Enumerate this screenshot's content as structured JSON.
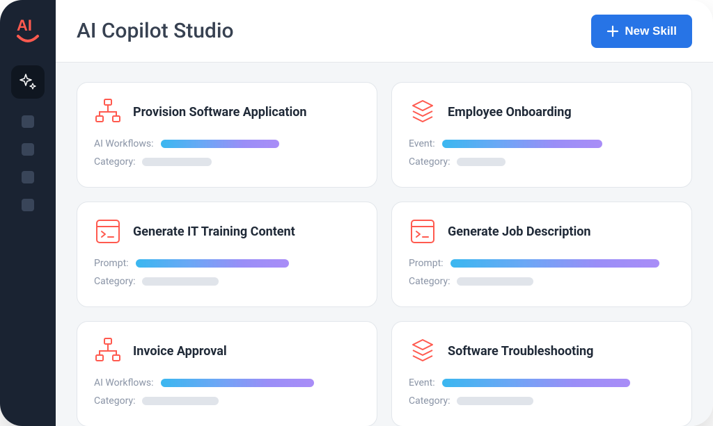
{
  "header": {
    "title": "AI Copilot Studio",
    "new_skill_label": "New Skill"
  },
  "sidebar": {
    "logo": "AI",
    "active_item": "sparkle"
  },
  "cards": [
    {
      "title": "Provision Software Application",
      "icon": "sitemap",
      "row1_label": "AI Workflows:",
      "row1_bar_width": 170,
      "row2_label": "Category:",
      "row2_bar_width": 100
    },
    {
      "title": "Employee Onboarding",
      "icon": "stack",
      "row1_label": "Event:",
      "row1_bar_width": 230,
      "row2_label": "Category:",
      "row2_bar_width": 70
    },
    {
      "title": "Generate IT Training Content",
      "icon": "terminal",
      "row1_label": "Prompt:",
      "row1_bar_width": 220,
      "row2_label": "Category:",
      "row2_bar_width": 110
    },
    {
      "title": "Generate Job Description",
      "icon": "terminal",
      "row1_label": "Prompt:",
      "row1_bar_width": 300,
      "row2_label": "Category:",
      "row2_bar_width": 110
    },
    {
      "title": "Invoice Approval",
      "icon": "sitemap",
      "row1_label": "AI Workflows:",
      "row1_bar_width": 220,
      "row2_label": "Category:",
      "row2_bar_width": 110
    },
    {
      "title": "Software Troubleshooting",
      "icon": "stack",
      "row1_label": "Event:",
      "row1_bar_width": 270,
      "row2_label": "Category:",
      "row2_bar_width": 110
    }
  ]
}
